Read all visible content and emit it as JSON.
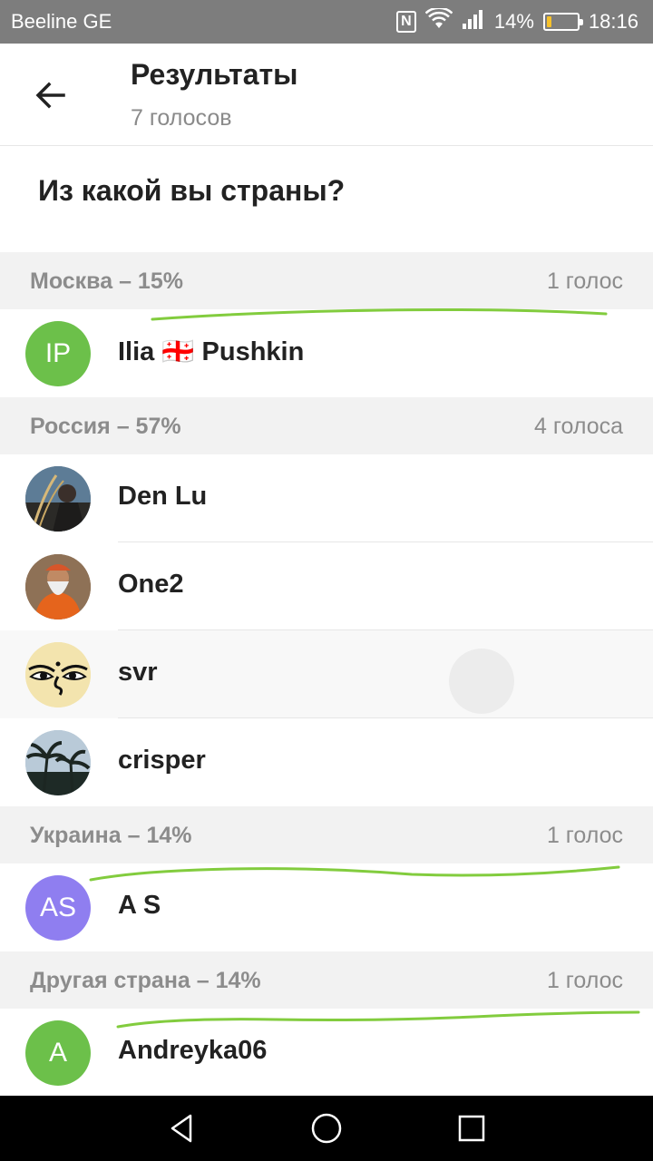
{
  "status_bar": {
    "carrier": "Beeline GE",
    "nfc": "N",
    "battery_percent": "14%",
    "battery_level": 0.14,
    "time": "18:16"
  },
  "header": {
    "title": "Результаты",
    "subtitle": "7 голосов"
  },
  "question": "Из какой вы страны?",
  "sections": [
    {
      "option": "Москва – 15%",
      "votes": "1 голос",
      "voters": [
        {
          "name": "Ilia 🇬🇪 Pushkin",
          "initials": "IP",
          "color": "#6cc04a"
        }
      ]
    },
    {
      "option": "Россия – 57%",
      "votes": "4 голоса",
      "voters": [
        {
          "name": "Den Lu",
          "photo": "photo-1"
        },
        {
          "name": "One2",
          "photo": "photo-2"
        },
        {
          "name": "svr",
          "photo": "buddha-eyes"
        },
        {
          "name": "crisper",
          "photo": "palms"
        }
      ]
    },
    {
      "option": "Украина – 14%",
      "votes": "1 голос",
      "voters": [
        {
          "name": "A S",
          "initials": "AS",
          "color": "#8f7ef0"
        }
      ]
    },
    {
      "option": "Другая страна – 14%",
      "votes": "1 голос",
      "voters": [
        {
          "name": "Andreyka06",
          "initials": "A",
          "color": "#6cc04a"
        }
      ]
    }
  ],
  "colors": {
    "annotation": "#82cc3e",
    "statusbar": "#7d7d7d",
    "section_bg": "#f2f2f2"
  }
}
